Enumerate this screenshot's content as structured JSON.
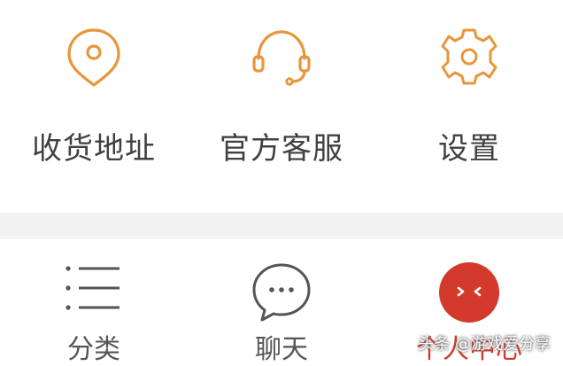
{
  "top_menu": {
    "items": [
      {
        "label": "收货地址",
        "icon": "location-pin-icon"
      },
      {
        "label": "官方客服",
        "icon": "headset-icon"
      },
      {
        "label": "设置",
        "icon": "gear-icon"
      }
    ]
  },
  "tab_bar": {
    "tabs": [
      {
        "label": "分类",
        "icon": "list-icon"
      },
      {
        "label": "聊天",
        "icon": "chat-bubble-icon"
      },
      {
        "label": "个人中心",
        "icon": "profile-face-icon",
        "active": true
      }
    ]
  },
  "watermark": "头条 @游戏爱分享",
  "colors": {
    "accent_orange": "#e8963a",
    "active_red": "#d33a2c",
    "text_gray": "#404040",
    "icon_gray": "#555555"
  }
}
